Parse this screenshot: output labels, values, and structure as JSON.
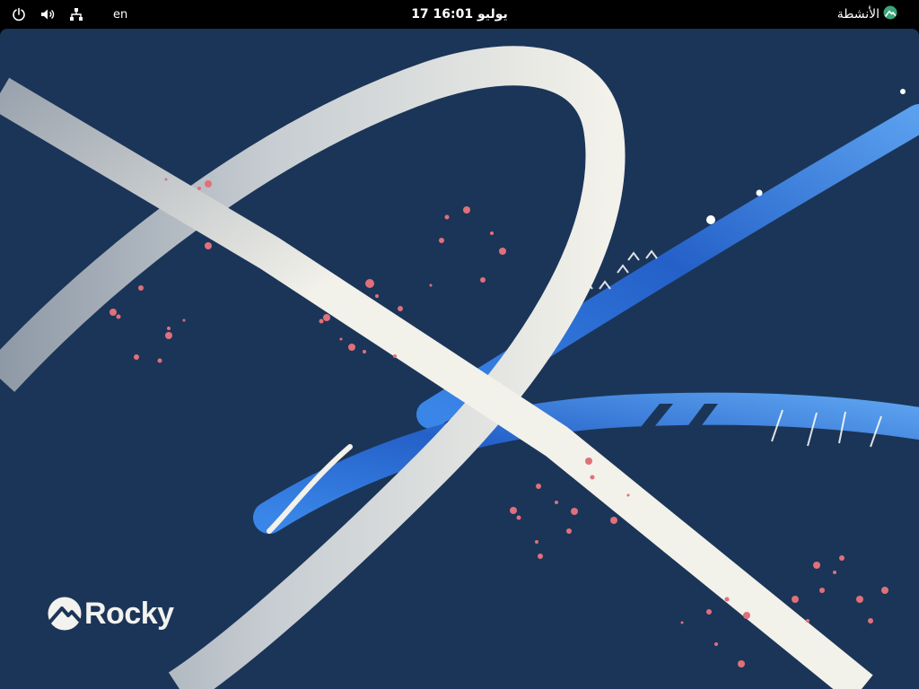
{
  "topbar": {
    "activities_label": "الأنشطة",
    "clock": "17 يوليو  16:01",
    "language": "en",
    "icons": [
      "power-icon",
      "volume-icon",
      "network-icon",
      "rocky-logo-icon"
    ]
  },
  "desktop": {
    "wallpaper_brand": "Rocky",
    "colors": {
      "background": "#1b3558",
      "ribbon": "#f2f1ea",
      "stripe": "#2f6fd6",
      "speckle": "#e0707a",
      "brand_mark": "#3aa677"
    }
  }
}
